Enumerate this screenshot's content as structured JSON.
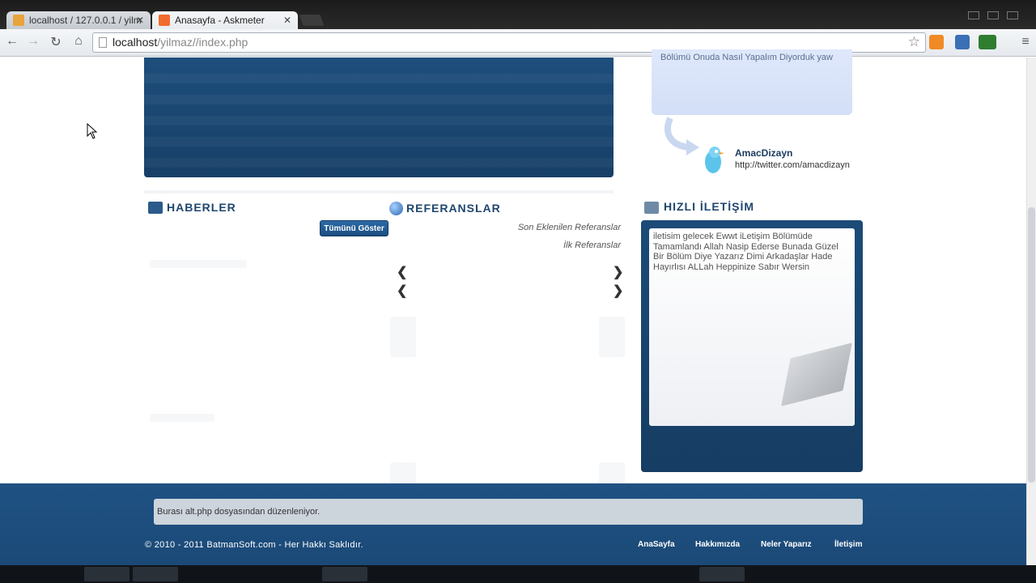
{
  "browser": {
    "tabs": [
      {
        "title": "localhost / 127.0.0.1 / yilm"
      },
      {
        "title": "Anasayfa - Askmeter"
      }
    ],
    "url_host": "localhost",
    "url_path": "/yilmaz//index.php"
  },
  "sidebar_tweet": {
    "text": "Bölümü Onuda Nasıl Yapalım Diyorduk yaw",
    "name": "AmacDizayn",
    "url": "http://twitter.com/amacdizayn"
  },
  "sections": {
    "haberler": "HABERLER",
    "referanslar": "REFERANSLAR",
    "hizli": "HIZLI İLETİŞİM"
  },
  "tumunu_goster": "Tümünü Göster",
  "referanslar": {
    "son": "Son Eklenilen Referanslar",
    "ilk": "İlk Referanslar"
  },
  "contact": {
    "text": "iletisim gelecek Ewwt iLetişim Bölümüde Tamamlandı Allah Nasip Ederse Bunada Güzel Bir Bölüm Diye Yazarız Dimi Arkadaşlar Hade Hayırlısı ALLah Heppinize Sabır Wersin"
  },
  "footer": {
    "message": "Burası alt.php dosyasından düzenleniyor.",
    "copyright": "© 2010 - 2011 BatmanSoft.com - Her Hakkı Saklıdır.",
    "nav": [
      "AnaSayfa",
      "Hakkımızda",
      "Neler Yaparız",
      "İletişim"
    ]
  },
  "icons": [
    "back-icon",
    "forward-icon",
    "reload-icon",
    "home-icon",
    "star-icon",
    "rss-icon",
    "folder-icon",
    "globe-icon",
    "twitter-bird-icon",
    "cursor-icon"
  ]
}
